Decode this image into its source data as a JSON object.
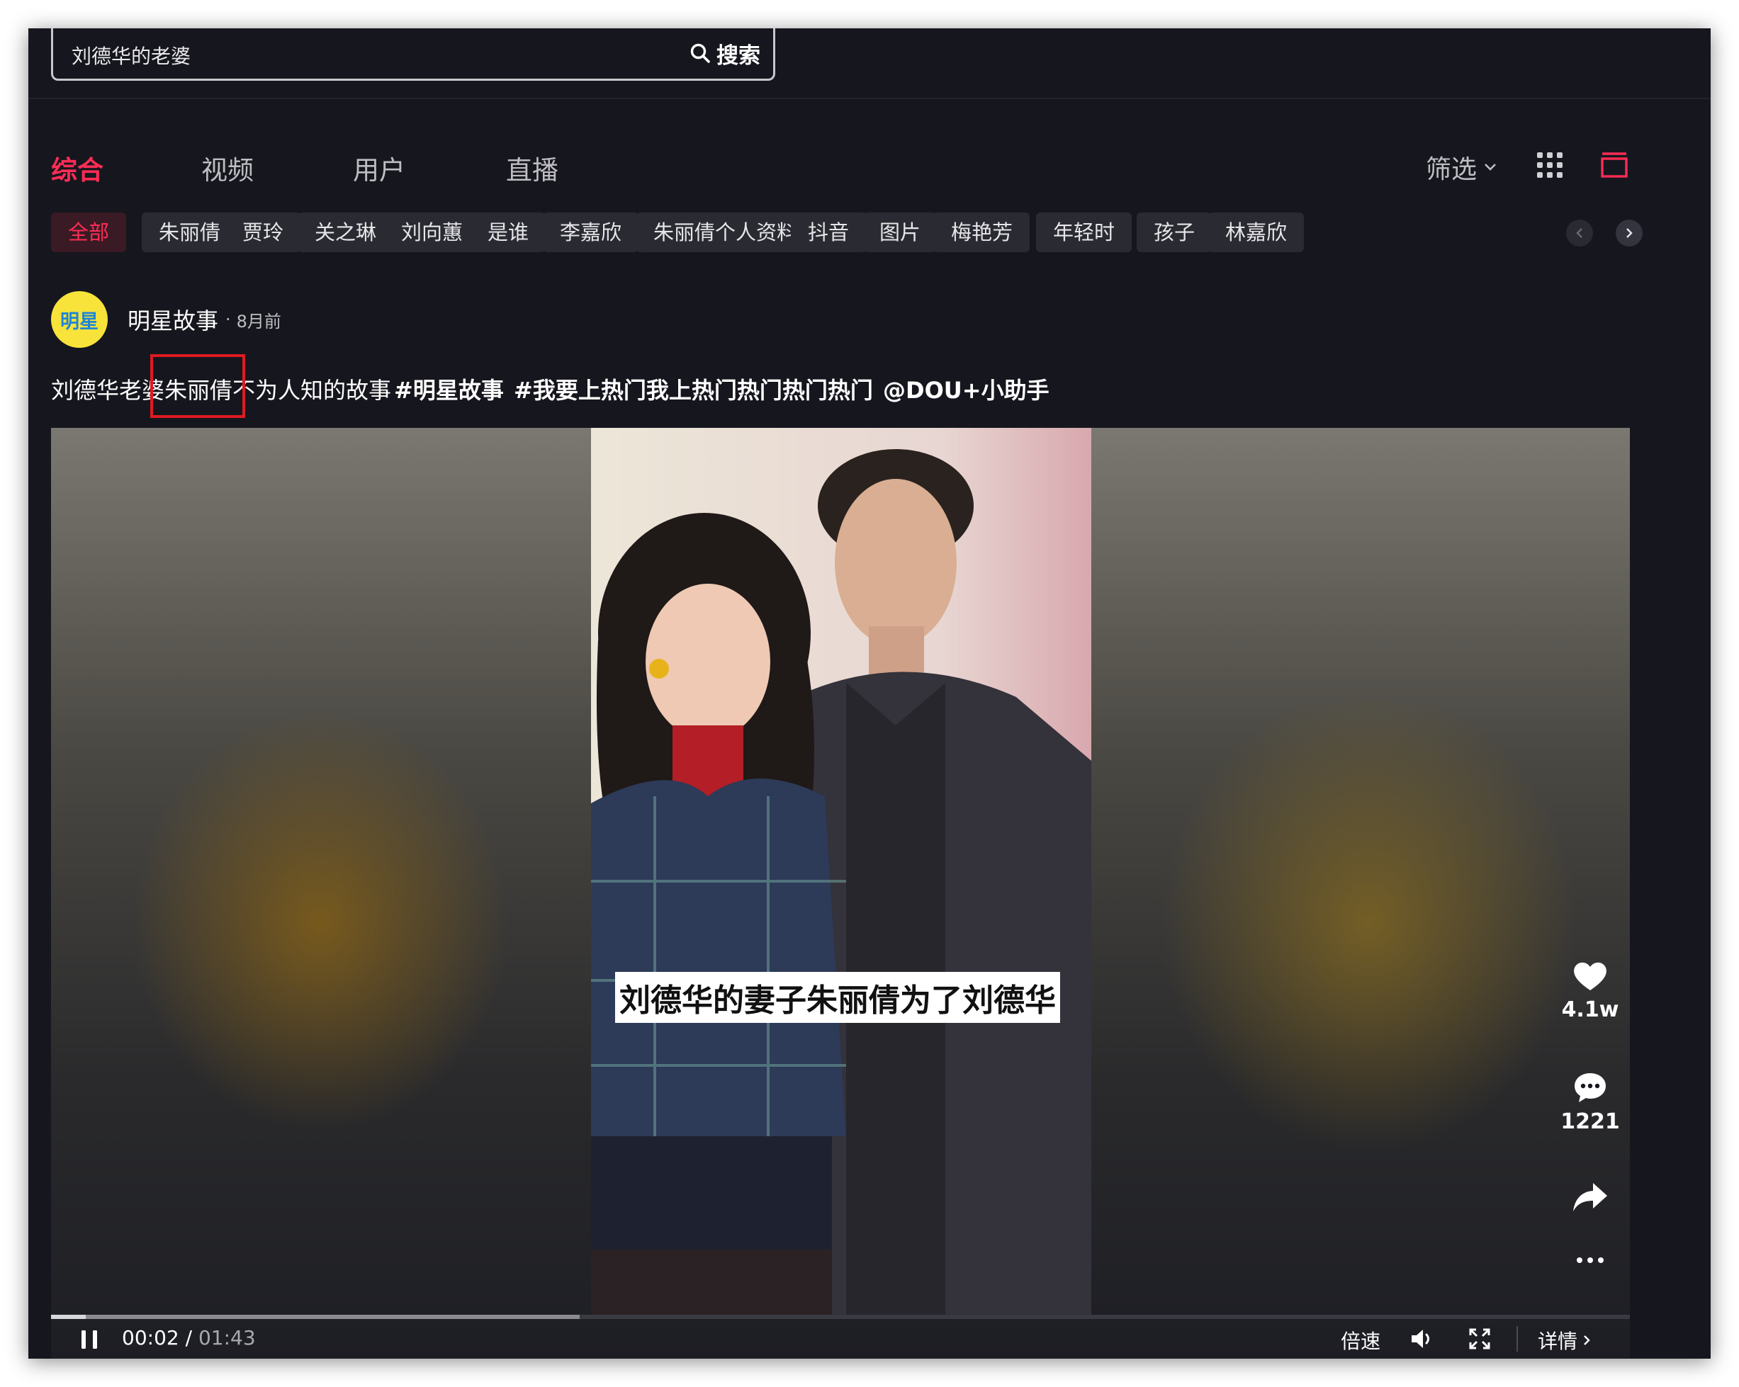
{
  "search": {
    "query": "刘德华的老婆",
    "button_label": "搜索"
  },
  "tabs": [
    {
      "label": "综合",
      "active": true
    },
    {
      "label": "视频",
      "active": false
    },
    {
      "label": "用户",
      "active": false
    },
    {
      "label": "直播",
      "active": false
    }
  ],
  "toolbar": {
    "filter_label": "筛选",
    "grid_icon": "grid-icon",
    "layout_icon": "single-column-icon"
  },
  "chips": [
    {
      "label": "全部",
      "active": true
    },
    {
      "label": "朱丽倩"
    },
    {
      "label": "贾玲"
    },
    {
      "label": "关之琳"
    },
    {
      "label": "刘向蕙"
    },
    {
      "label": "是谁"
    },
    {
      "label": "李嘉欣"
    },
    {
      "label": "朱丽倩个人资料"
    },
    {
      "label": "抖音"
    },
    {
      "label": "图片"
    },
    {
      "label": "梅艳芳"
    },
    {
      "label": "年轻时"
    },
    {
      "label": "孩子"
    },
    {
      "label": "林嘉欣"
    }
  ],
  "post": {
    "avatar_text": "明星",
    "author": "明星故事",
    "separator": "·",
    "time": "8月前",
    "description": "刘德华老婆朱丽倩不为人知的故事",
    "hashtags": [
      "#明星故事",
      "#我要上热门我上热门热门热门热门",
      "@DOU+小助手"
    ]
  },
  "video": {
    "subtitle": "刘德华的妻子朱丽倩为了刘德华",
    "likes": "4.1w",
    "comments": "1221",
    "current_time": "00:02",
    "time_separator": "/",
    "total_time": "01:43",
    "progress": 0.022,
    "buffered": 0.335,
    "speed_label": "倍速",
    "details_label": "详情"
  },
  "colors": {
    "accent": "#fe2c55",
    "background": "#16161e",
    "chip_bg": "#2a2a33",
    "highlight_box": "#e01a22"
  }
}
